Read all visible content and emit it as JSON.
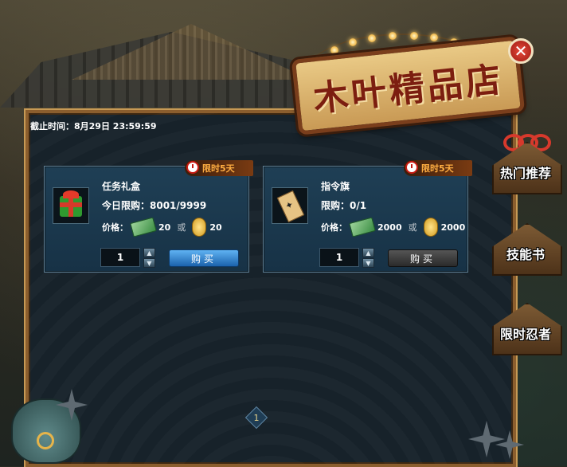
{
  "shop": {
    "title": "木叶精品店",
    "close_label": "✕",
    "deadline": "截止时间：8月29日 23:59:59"
  },
  "items": [
    {
      "name": "任务礼盒",
      "limit_badge": "限时5天",
      "limit_text": "今日限购：8001/9999",
      "price_label": "价格：",
      "cash_price": "20",
      "or_text": "或",
      "gold_price": "20",
      "quantity": "1",
      "buy_label": "购买",
      "buy_enabled": true,
      "icon": "gift-box-icon"
    },
    {
      "name": "指令旗",
      "limit_badge": "限时5天",
      "limit_text": "限购：0/1",
      "price_label": "价格：",
      "cash_price": "2000",
      "or_text": "或",
      "gold_price": "2000",
      "quantity": "1",
      "buy_label": "购买",
      "buy_enabled": false,
      "icon": "command-flag-icon"
    }
  ],
  "side_tabs": [
    {
      "label": "热门推荐",
      "active": true
    },
    {
      "label": "技能书",
      "active": false
    },
    {
      "label": "限时忍者",
      "active": false
    }
  ],
  "pagination": {
    "current_page": "1"
  },
  "colors": {
    "accent_blue": "#1b63ad",
    "badge_orange": "#ffae42",
    "frame_brown": "#8b5e2e",
    "sign_red": "#7c1e10"
  }
}
